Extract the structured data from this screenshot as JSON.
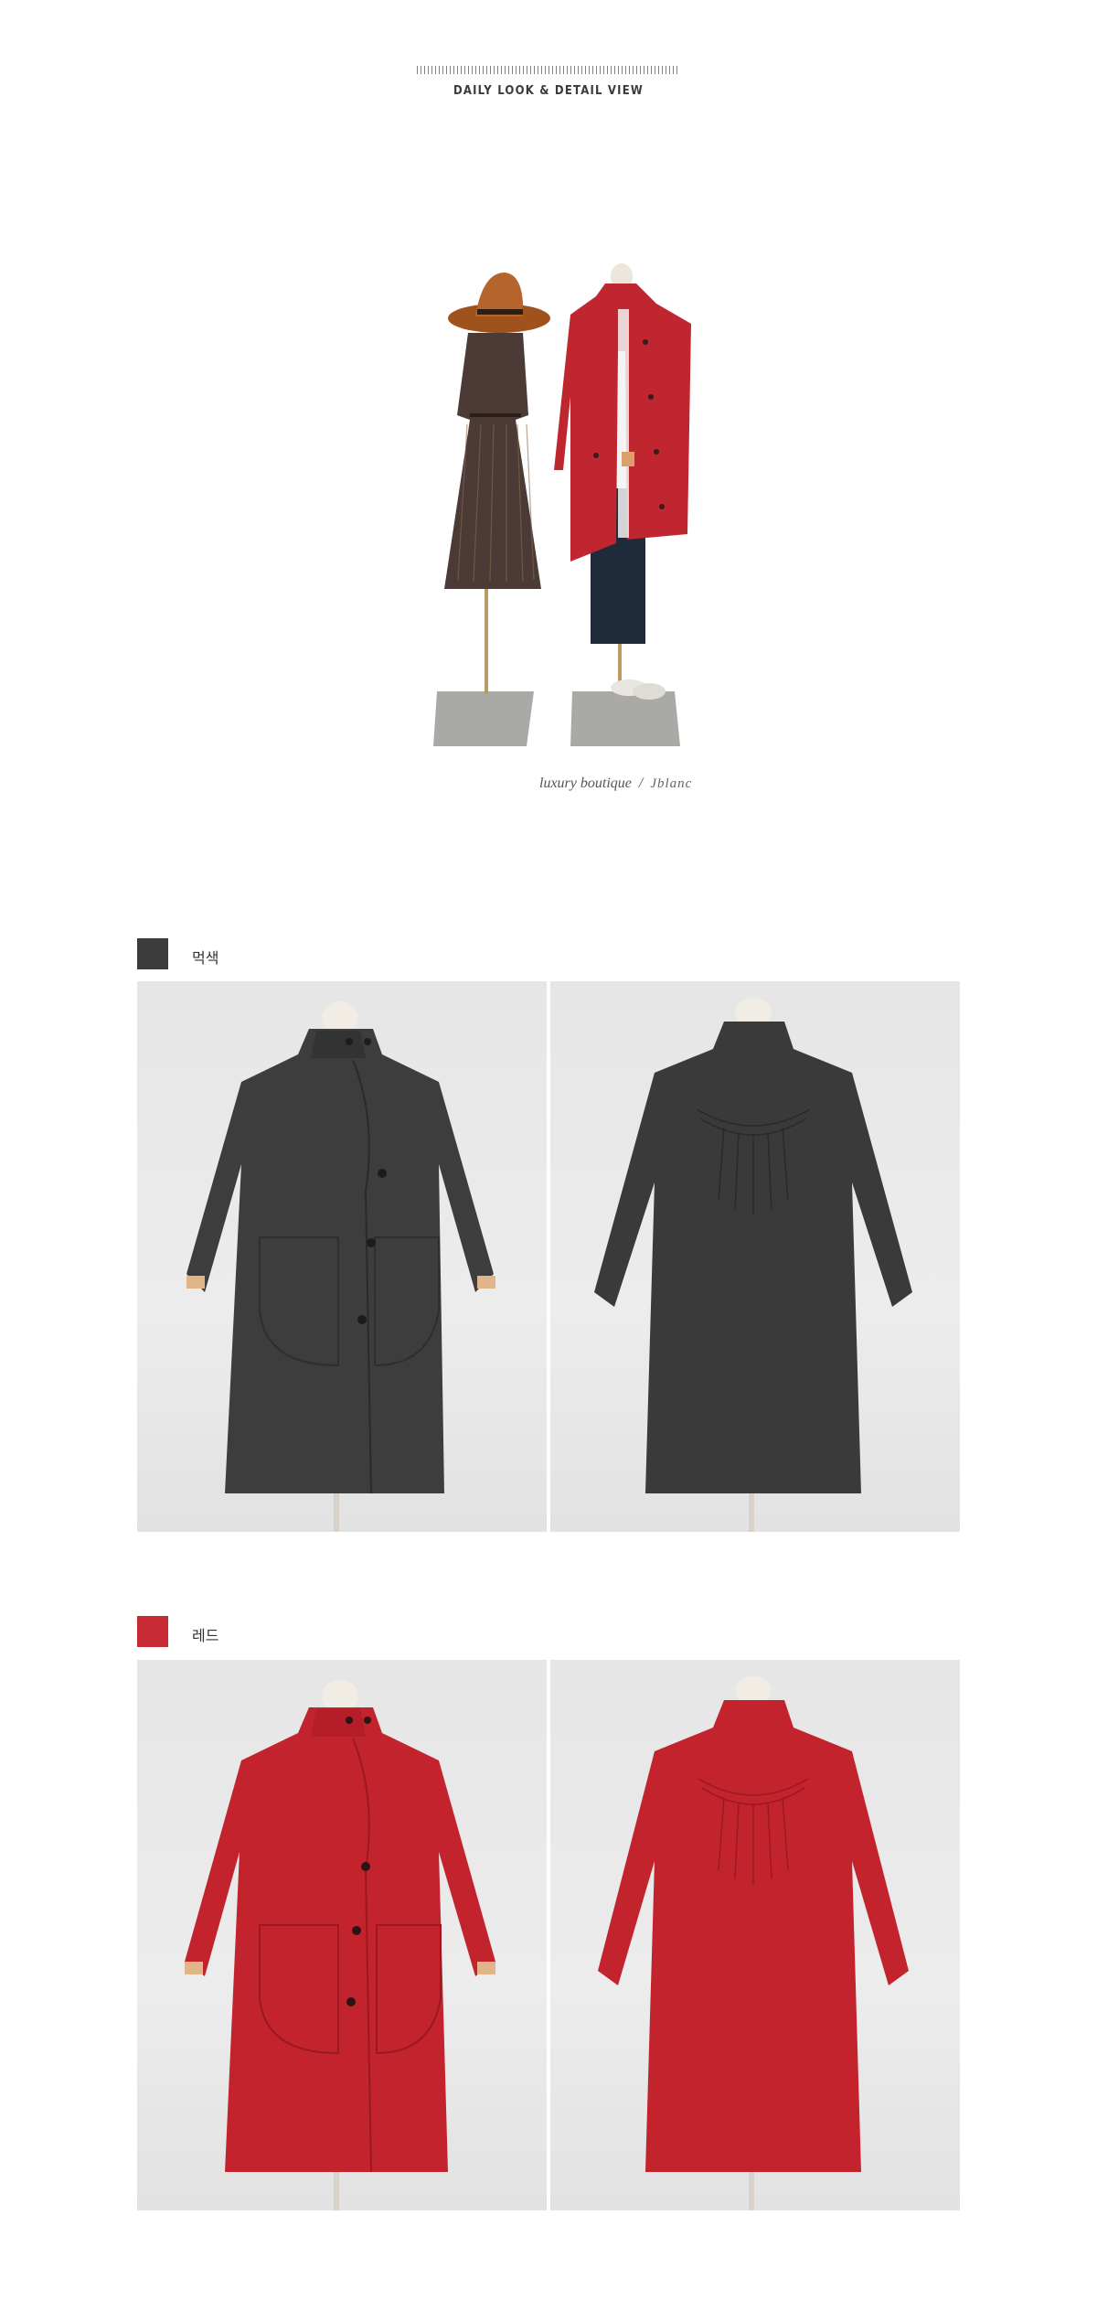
{
  "header": {
    "title": "DAILY LOOK & DETAIL VIEW"
  },
  "signature": {
    "text": "luxury boutique",
    "separator": "/",
    "brand_script": "Jblanc"
  },
  "colors": {
    "dark": "#3b3b3b",
    "red": "#c72b36"
  },
  "sections": [
    {
      "name": "먹색",
      "swatch": "#3b3b3b",
      "views": [
        "front",
        "back"
      ]
    },
    {
      "name": "레드",
      "swatch": "#c72b36",
      "views": [
        "front",
        "back"
      ]
    }
  ]
}
